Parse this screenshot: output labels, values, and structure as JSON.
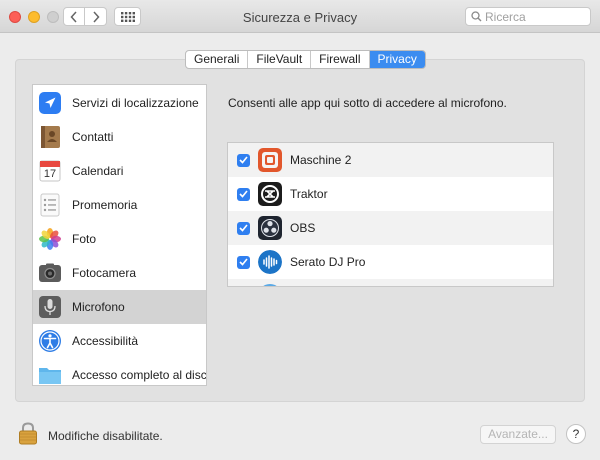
{
  "window": {
    "title": "Sicurezza e Privacy",
    "search_placeholder": "Ricerca"
  },
  "tabs": [
    {
      "label": "Generali",
      "active": false
    },
    {
      "label": "FileVault",
      "active": false
    },
    {
      "label": "Firewall",
      "active": false
    },
    {
      "label": "Privacy",
      "active": true
    }
  ],
  "sidebar": {
    "items": [
      {
        "label": "Servizi di localizzazione",
        "icon": "location-arrow-icon",
        "selected": false
      },
      {
        "label": "Contatti",
        "icon": "contacts-book-icon",
        "selected": false
      },
      {
        "label": "Calendari",
        "icon": "calendar-icon",
        "selected": false,
        "icon_text": "17"
      },
      {
        "label": "Promemoria",
        "icon": "reminders-list-icon",
        "selected": false
      },
      {
        "label": "Foto",
        "icon": "photos-flower-icon",
        "selected": false
      },
      {
        "label": "Fotocamera",
        "icon": "camera-icon",
        "selected": false
      },
      {
        "label": "Microfono",
        "icon": "microphone-icon",
        "selected": true
      },
      {
        "label": "Accessibilità",
        "icon": "accessibility-icon",
        "selected": false
      },
      {
        "label": "Accesso completo al disco",
        "icon": "folder-icon",
        "selected": false
      }
    ]
  },
  "content": {
    "description": "Consenti alle app qui sotto di accedere al microfono.",
    "apps": [
      {
        "label": "Maschine 2",
        "icon": "maschine-icon",
        "checked": true
      },
      {
        "label": "Traktor",
        "icon": "traktor-icon",
        "checked": true
      },
      {
        "label": "OBS",
        "icon": "obs-icon",
        "checked": true
      },
      {
        "label": "Serato DJ Pro",
        "icon": "serato-icon",
        "checked": true
      }
    ]
  },
  "footer": {
    "lock_text": "Modifiche disabilitate.",
    "advanced_label": "Avanzate...",
    "help_label": "?"
  },
  "colors": {
    "accent": "#3b8cf0",
    "checkbox": "#2f7ff0",
    "selected_row": "#d3d3d3"
  }
}
